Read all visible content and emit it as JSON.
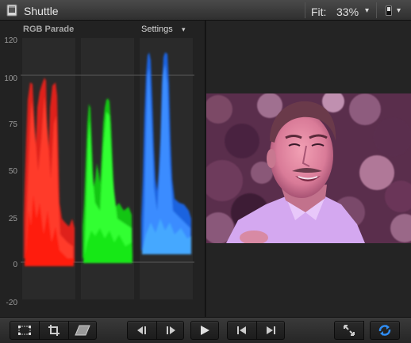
{
  "window": {
    "title": "Shuttle",
    "fit_label": "Fit:",
    "fit_value": "33%",
    "fit_chevron": "▾",
    "toggle_chevron": "▾",
    "app_icon": "clapper-document-icon",
    "toggle_icon": "switch-toggle-icon"
  },
  "scope": {
    "title": "RGB Parade",
    "settings_label": "Settings",
    "settings_chevron": "▾",
    "axis_labels": [
      "120",
      "100",
      "75",
      "50",
      "25",
      "0",
      "-20"
    ],
    "channels": [
      {
        "name": "red",
        "color": "#ff2a1a"
      },
      {
        "name": "green",
        "color": "#22ee22"
      },
      {
        "name": "blue",
        "color": "#2a7bff"
      }
    ]
  },
  "viewer": {
    "image": "man-in-light-blue-shirt-smiling-trees-background"
  },
  "toolbar": {
    "left_buttons": [
      "transform-icon",
      "crop-icon",
      "distort-icon"
    ],
    "nav_buttons": [
      "previous-frame-icon",
      "next-frame-icon"
    ],
    "play_button": "play-icon",
    "edit_buttons": [
      "go-to-start-icon",
      "go-to-end-icon"
    ],
    "right_buttons": [
      "fullscreen-icon",
      "loop-icon"
    ],
    "accent_color": "#2f8df5"
  }
}
